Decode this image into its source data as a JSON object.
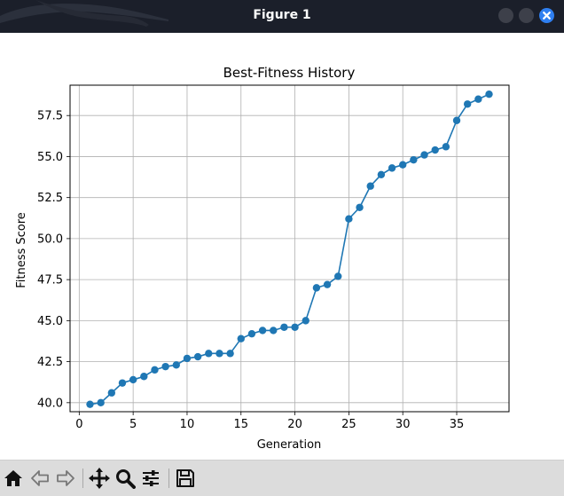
{
  "window": {
    "title": "Figure 1"
  },
  "chart_data": {
    "type": "line",
    "title": "Best-Fitness History",
    "xlabel": "Generation",
    "ylabel": "Fitness Score",
    "xlim": [
      -0.85,
      39.85
    ],
    "ylim": [
      39.45,
      59.35
    ],
    "xticks": [
      0,
      5,
      10,
      15,
      20,
      25,
      30,
      35
    ],
    "yticks": [
      40.0,
      42.5,
      45.0,
      47.5,
      50.0,
      52.5,
      55.0,
      57.5
    ],
    "xtick_labels": [
      "0",
      "5",
      "10",
      "15",
      "20",
      "25",
      "30",
      "35"
    ],
    "ytick_labels": [
      "40.0",
      "42.5",
      "45.0",
      "47.5",
      "50.0",
      "52.5",
      "55.0",
      "57.5"
    ],
    "grid": true,
    "marker": "circle",
    "color": "#1f77b4",
    "x": [
      1,
      2,
      3,
      4,
      5,
      6,
      7,
      8,
      9,
      10,
      11,
      12,
      13,
      14,
      15,
      16,
      17,
      18,
      19,
      20,
      21,
      22,
      23,
      24,
      25,
      26,
      27,
      28,
      29,
      30,
      31,
      32,
      33,
      34,
      35,
      36,
      37,
      38
    ],
    "y": [
      39.9,
      40.0,
      40.6,
      41.2,
      41.4,
      41.6,
      42.0,
      42.2,
      42.3,
      42.7,
      42.8,
      43.0,
      43.0,
      43.0,
      43.9,
      44.2,
      44.4,
      44.4,
      44.6,
      44.6,
      45.0,
      47.0,
      47.2,
      47.7,
      51.2,
      51.9,
      53.2,
      53.9,
      54.3,
      54.5,
      54.8,
      55.1,
      55.4,
      55.6,
      57.2,
      58.2,
      58.5,
      58.8
    ]
  },
  "toolbar": {
    "buttons": [
      {
        "name": "home-icon"
      },
      {
        "name": "back-icon"
      },
      {
        "name": "forward-icon"
      },
      {
        "name": "pan-icon"
      },
      {
        "name": "zoom-icon"
      },
      {
        "name": "configure-subplots-icon"
      },
      {
        "name": "save-icon"
      }
    ]
  }
}
